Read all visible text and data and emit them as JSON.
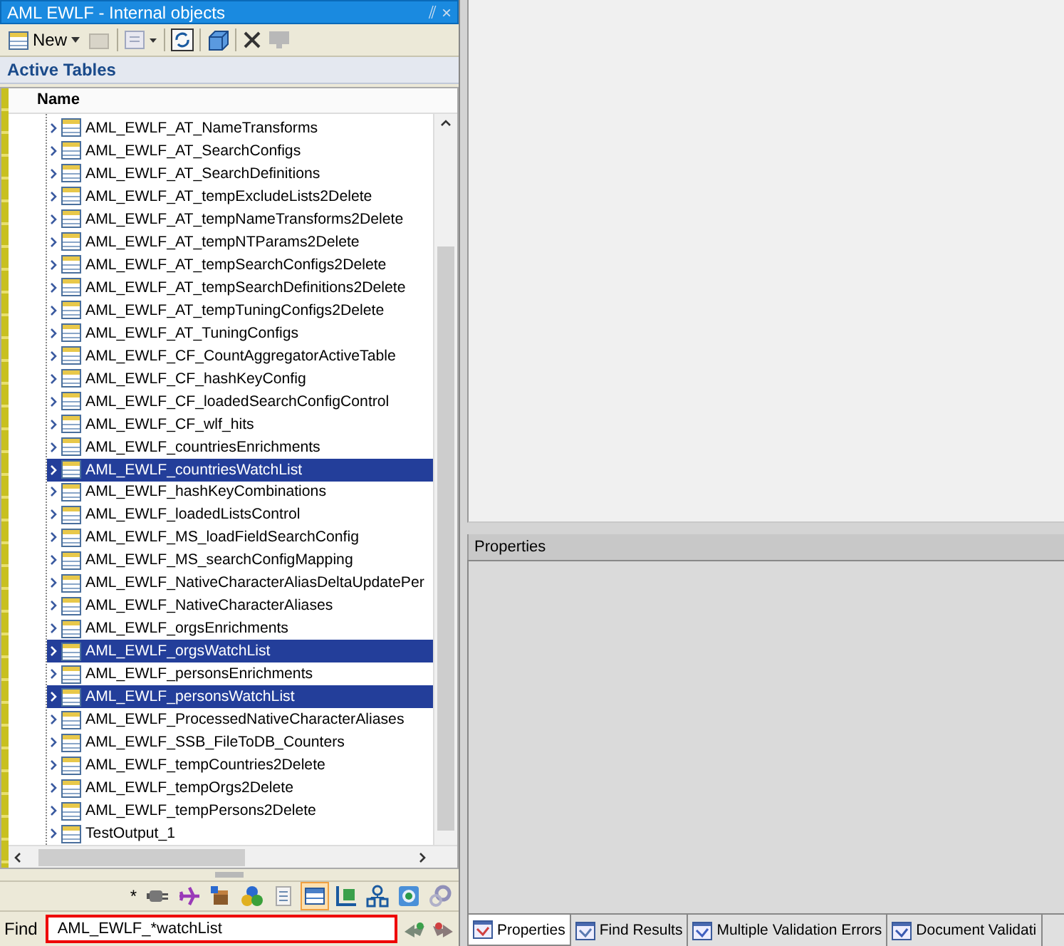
{
  "panel": {
    "title": "AML EWLF - Internal objects",
    "pin": "⫽",
    "close": "×"
  },
  "toolbar": {
    "new_label": "New"
  },
  "section_title": "Active Tables",
  "tree": {
    "column": "Name",
    "rows": [
      {
        "label": "AML_EWLF_AT_NameTransforms",
        "selected": false
      },
      {
        "label": "AML_EWLF_AT_SearchConfigs",
        "selected": false
      },
      {
        "label": "AML_EWLF_AT_SearchDefinitions",
        "selected": false
      },
      {
        "label": "AML_EWLF_AT_tempExcludeLists2Delete",
        "selected": false
      },
      {
        "label": "AML_EWLF_AT_tempNameTransforms2Delete",
        "selected": false
      },
      {
        "label": "AML_EWLF_AT_tempNTParams2Delete",
        "selected": false
      },
      {
        "label": "AML_EWLF_AT_tempSearchConfigs2Delete",
        "selected": false
      },
      {
        "label": "AML_EWLF_AT_tempSearchDefinitions2Delete",
        "selected": false
      },
      {
        "label": "AML_EWLF_AT_tempTuningConfigs2Delete",
        "selected": false
      },
      {
        "label": "AML_EWLF_AT_TuningConfigs",
        "selected": false
      },
      {
        "label": "AML_EWLF_CF_CountAggregatorActiveTable",
        "selected": false
      },
      {
        "label": "AML_EWLF_CF_hashKeyConfig",
        "selected": false
      },
      {
        "label": "AML_EWLF_CF_loadedSearchConfigControl",
        "selected": false
      },
      {
        "label": "AML_EWLF_CF_wlf_hits",
        "selected": false
      },
      {
        "label": "AML_EWLF_countriesEnrichments",
        "selected": false
      },
      {
        "label": "AML_EWLF_countriesWatchList",
        "selected": true
      },
      {
        "label": "AML_EWLF_hashKeyCombinations",
        "selected": false
      },
      {
        "label": "AML_EWLF_loadedListsControl",
        "selected": false
      },
      {
        "label": "AML_EWLF_MS_loadFieldSearchConfig",
        "selected": false
      },
      {
        "label": "AML_EWLF_MS_searchConfigMapping",
        "selected": false
      },
      {
        "label": "AML_EWLF_NativeCharacterAliasDeltaUpdatePer",
        "selected": false
      },
      {
        "label": "AML_EWLF_NativeCharacterAliases",
        "selected": false
      },
      {
        "label": "AML_EWLF_orgsEnrichments",
        "selected": false
      },
      {
        "label": "AML_EWLF_orgsWatchList",
        "selected": true
      },
      {
        "label": "AML_EWLF_personsEnrichments",
        "selected": false
      },
      {
        "label": "AML_EWLF_personsWatchList",
        "selected": true
      },
      {
        "label": "AML_EWLF_ProcessedNativeCharacterAliases",
        "selected": false
      },
      {
        "label": "AML_EWLF_SSB_FileToDB_Counters",
        "selected": false
      },
      {
        "label": "AML_EWLF_tempCountries2Delete",
        "selected": false
      },
      {
        "label": "AML_EWLF_tempOrgs2Delete",
        "selected": false
      },
      {
        "label": "AML_EWLF_tempPersons2Delete",
        "selected": false
      },
      {
        "label": "TestOutput_1",
        "selected": false
      }
    ]
  },
  "object_tools": {
    "star": "*",
    "items": [
      {
        "kind": "plug",
        "selected": false
      },
      {
        "kind": "plane",
        "selected": false
      },
      {
        "kind": "box",
        "selected": false
      },
      {
        "kind": "shapes",
        "selected": false
      },
      {
        "kind": "document",
        "selected": false
      },
      {
        "kind": "table",
        "selected": true
      },
      {
        "kind": "chart",
        "selected": false
      },
      {
        "kind": "diagram",
        "selected": false
      },
      {
        "kind": "globe",
        "selected": false
      },
      {
        "kind": "gear",
        "selected": false
      }
    ]
  },
  "find": {
    "label": "Find",
    "value": "AML_EWLF_*watchList"
  },
  "properties": {
    "title": "Properties"
  },
  "bottom_tabs": [
    {
      "label": "Properties",
      "selected": true
    },
    {
      "label": "Find Results",
      "selected": false
    },
    {
      "label": "Multiple Validation Errors",
      "selected": false
    },
    {
      "label": "Document Validati",
      "selected": false
    }
  ]
}
